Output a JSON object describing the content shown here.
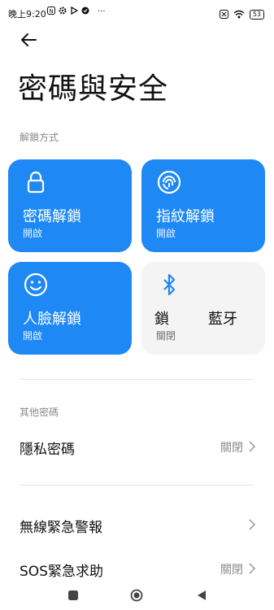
{
  "status_bar": {
    "time": "晚上9:20",
    "left_icons": [
      "notification-icon",
      "settings-icon",
      "play-icon",
      "check-icon"
    ],
    "more": "···",
    "battery": "53"
  },
  "page": {
    "title": "密碼與安全"
  },
  "unlock_section": {
    "label": "解鎖方式",
    "tiles": [
      {
        "label": "密碼解鎖",
        "status": "開啟",
        "icon": "lock-icon",
        "state": "on"
      },
      {
        "label": "指紋解鎖",
        "status": "開啟",
        "icon": "fingerprint-icon",
        "state": "on"
      },
      {
        "label": "人臉解鎖",
        "status": "開啟",
        "icon": "face-icon",
        "state": "on"
      },
      {
        "label_left": "鎖",
        "label_right": "藍牙",
        "status": "關閉",
        "icon": "bluetooth-icon",
        "state": "off"
      }
    ]
  },
  "other_section": {
    "label": "其他密碼",
    "items": [
      {
        "label": "隱私密碼",
        "value": "關閉"
      },
      {
        "label": "無線緊急警報",
        "value": ""
      },
      {
        "label": "SOS緊急求助",
        "value": "關閉"
      }
    ]
  },
  "colors": {
    "accent": "#1e88f5",
    "tile_off": "#f4f4f4",
    "secondary_text": "#8a8a8a"
  },
  "nav_bar": {
    "buttons": [
      "recent-apps-icon",
      "home-icon",
      "back-icon"
    ]
  }
}
